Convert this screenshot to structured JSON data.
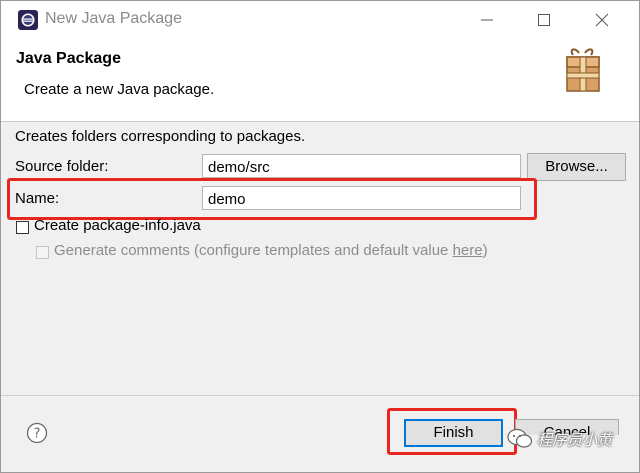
{
  "window": {
    "title": "New Java Package"
  },
  "header": {
    "title": "Java Package",
    "description": "Create a new Java package."
  },
  "form": {
    "intro": "Creates folders corresponding to packages.",
    "source_folder_label": "Source folder:",
    "source_folder_value": "demo/src",
    "browse_label": "Browse...",
    "name_label": "Name:",
    "name_value": "demo",
    "create_package_info_label": "Create package-info.java",
    "create_package_info_checked": false,
    "generate_comments_text": "Generate comments (configure templates and default value ",
    "generate_comments_link": "here",
    "generate_comments_suffix": ")",
    "generate_comments_enabled": false
  },
  "footer": {
    "finish_label": "Finish",
    "cancel_label": "Cancel"
  },
  "watermark": {
    "text": "程序员小黄"
  },
  "colors": {
    "highlight": "#e8251e",
    "focus_blue": "#0078d7"
  }
}
